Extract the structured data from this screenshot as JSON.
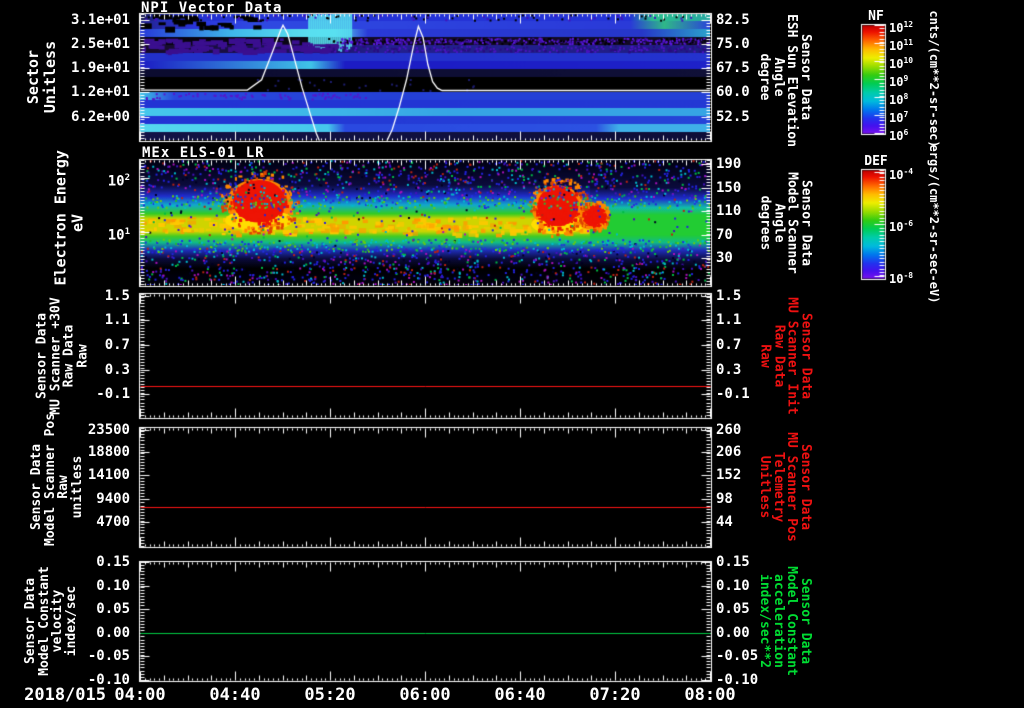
{
  "x_axis": {
    "date_label": "2018/015",
    "tick_labels": [
      "04:00",
      "04:40",
      "05:20",
      "06:00",
      "06:40",
      "07:20",
      "08:00"
    ]
  },
  "panels": [
    {
      "key": "npi",
      "title": "NPI Vector Data",
      "type": "spectrogram",
      "left": {
        "lines": [
          "Sector",
          "Unitless"
        ],
        "ticks": [
          "3.1e+01",
          "2.5e+01",
          "1.9e+01",
          "1.2e+01",
          "6.2e+00"
        ],
        "color": "#ffffff"
      },
      "right": {
        "lines": [
          "Sensor Data",
          "ESH Sun Elevation",
          "Angle",
          "degree"
        ],
        "ticks": [
          "82.5",
          "75.0",
          "67.5",
          "60.0",
          "52.5"
        ],
        "color": "#ffffff"
      }
    },
    {
      "key": "els",
      "title": "MEx ELS-01 LR",
      "type": "spectrogram",
      "left": {
        "lines": [
          "Electron Energy",
          "eV"
        ],
        "ticks": [
          {
            "base": "10",
            "exp": "2"
          },
          {
            "base": "10",
            "exp": "1"
          }
        ],
        "color": "#ffffff"
      },
      "right": {
        "lines": [
          "Sensor Data",
          "Model Scanner",
          "Angle",
          "degrees"
        ],
        "ticks": [
          "190",
          "150",
          "110",
          "70",
          "30"
        ],
        "color": "#ffffff"
      }
    },
    {
      "key": "mu-scanner-30v",
      "type": "line",
      "left": {
        "lines": [
          "Sensor Data",
          "MU Scanner +30V",
          "Raw Data",
          "Raw"
        ],
        "ticks": [
          "1.5",
          "1.1",
          "0.7",
          "0.3",
          "-0.1"
        ],
        "color": "#ffffff"
      },
      "right": {
        "lines": [
          "Sensor Data",
          "MU Scanner Init",
          "Raw Data",
          "Raw"
        ],
        "ticks": [
          "1.5",
          "1.1",
          "0.7",
          "0.3",
          "-0.1"
        ],
        "color": "#ee1111"
      }
    },
    {
      "key": "model-scanner-pos",
      "type": "line",
      "left": {
        "lines": [
          "Sensor Data",
          "Model Scanner Pos",
          "Raw",
          "unitless"
        ],
        "ticks": [
          "23500",
          "18800",
          "14100",
          "9400",
          "4700"
        ],
        "color": "#ffffff"
      },
      "right": {
        "lines": [
          "Sensor Data",
          "MU Scanner Pos",
          "Telemetry",
          "Unitless"
        ],
        "ticks": [
          "260",
          "206",
          "152",
          "98",
          "44"
        ],
        "color": "#ee1111"
      }
    },
    {
      "key": "model-constant",
      "type": "line",
      "left": {
        "lines": [
          "Sensor Data",
          "Model Constant",
          "velocity",
          "index/sec"
        ],
        "ticks": [
          "0.15",
          "0.10",
          "0.05",
          "0.00",
          "-0.05",
          "-0.10"
        ],
        "color": "#ffffff"
      },
      "right": {
        "lines": [
          "Sensor Data",
          "Model Constant",
          "acceleration",
          "index/sec**2"
        ],
        "ticks": [
          "0.15",
          "0.10",
          "0.05",
          "0.00",
          "-0.05",
          "-0.10"
        ],
        "color": "#00dd33"
      }
    }
  ],
  "colorbars": [
    {
      "title": "NF",
      "unit": "cnts/(cm**2-sr-sec)",
      "ticks": [
        {
          "base": "10",
          "exp": "12"
        },
        {
          "base": "10",
          "exp": "11"
        },
        {
          "base": "10",
          "exp": "10"
        },
        {
          "base": "10",
          "exp": "9"
        },
        {
          "base": "10",
          "exp": "8"
        },
        {
          "base": "10",
          "exp": "7"
        },
        {
          "base": "10",
          "exp": "6"
        }
      ]
    },
    {
      "title": "DEF",
      "unit": "ergs/(cm**2-sr-sec-eV)",
      "ticks": [
        {
          "base": "10",
          "exp": "-4"
        },
        {
          "base": "10",
          "exp": "-6"
        },
        {
          "base": "10",
          "exp": "-8"
        }
      ]
    }
  ],
  "colorbar_gradient": [
    [
      0,
      "#c00000"
    ],
    [
      0.06,
      "#ee1100"
    ],
    [
      0.14,
      "#ff6600"
    ],
    [
      0.22,
      "#ffbb00"
    ],
    [
      0.3,
      "#eeee00"
    ],
    [
      0.38,
      "#99dd00"
    ],
    [
      0.46,
      "#33cc11"
    ],
    [
      0.54,
      "#00cc55"
    ],
    [
      0.62,
      "#00ccaa"
    ],
    [
      0.7,
      "#00bbdd"
    ],
    [
      0.78,
      "#0077ee"
    ],
    [
      0.86,
      "#2233ee"
    ],
    [
      0.93,
      "#4411ee"
    ],
    [
      1,
      "#7711ee"
    ]
  ],
  "chart_data": [
    {
      "panel": "NPI Vector Data",
      "type": "heatmap",
      "x_date": "2018/015",
      "x_range": [
        "04:00",
        "08:00"
      ],
      "y_axis": {
        "label": "Sector Unitless",
        "ticks": [
          31,
          25,
          19,
          12,
          6.2
        ]
      },
      "y2_axis": {
        "label": "Sensor Data ESH Sun Elevation Angle (degree)",
        "ticks": [
          82.5,
          75.0,
          67.5,
          60.0,
          52.5
        ]
      },
      "z_axis": {
        "label": "NF cnts/(cm**2-sr-sec)",
        "scale": "log",
        "range": [
          1000000.0,
          1000000000000.0
        ]
      },
      "overlay_series": {
        "name": "white-trace",
        "color": "#ffffff",
        "points_min_value": [
          [
            240,
            13.3
          ],
          [
            285,
            13.3
          ],
          [
            291,
            16
          ],
          [
            296,
            24
          ],
          [
            299,
            29
          ],
          [
            300,
            30.3
          ],
          [
            302,
            28
          ],
          [
            305,
            21
          ],
          [
            308,
            14
          ],
          [
            311,
            8
          ],
          [
            314,
            2
          ],
          [
            316,
            -1
          ],
          [
            343,
            -1
          ],
          [
            346,
            3
          ],
          [
            349,
            9
          ],
          [
            352,
            16
          ],
          [
            355,
            25
          ],
          [
            357,
            30.0
          ],
          [
            359,
            27
          ],
          [
            361,
            20
          ],
          [
            363,
            15.5
          ],
          [
            365,
            13.8
          ],
          [
            367,
            13.2
          ],
          [
            480,
            13.2
          ]
        ]
      },
      "texture": {
        "rows": [
          [
            [
              0,
              "#151540"
            ],
            [
              0.04,
              "#2230cc"
            ],
            [
              0.2,
              "#2433d6"
            ],
            [
              0.86,
              "#2433d6"
            ],
            [
              0.9,
              "#2bbf8f"
            ],
            [
              1,
              "#27a8a0"
            ]
          ],
          [
            [
              0,
              "#23238f"
            ],
            [
              0.1,
              "#2a35dd"
            ],
            [
              0.2,
              "#2f49e2"
            ],
            [
              0.86,
              "#2a3ad8"
            ],
            [
              0.92,
              "#2fb889"
            ],
            [
              1,
              "#2a44d8"
            ]
          ],
          [
            [
              0,
              "#2638d8"
            ],
            [
              0.16,
              "#3fb7ea"
            ],
            [
              0.26,
              "#54d6ee"
            ],
            [
              0.34,
              "#63e4f2"
            ],
            [
              0.4,
              "#2a3ad8"
            ],
            [
              0.88,
              "#2637c9"
            ],
            [
              1,
              "#2ba3cc"
            ]
          ],
          [
            [
              0,
              "#07030f"
            ],
            [
              0.3,
              "#0a0616"
            ],
            [
              0.34,
              "#120a24"
            ],
            [
              1,
              "#120a24"
            ]
          ],
          [
            [
              0,
              "#170b26"
            ],
            [
              0.33,
              "#1d1468"
            ],
            [
              0.42,
              "#232090"
            ],
            [
              1,
              "#201d85"
            ]
          ],
          [
            [
              0,
              "#2230c9"
            ],
            [
              1,
              "#2433cf"
            ]
          ],
          [
            [
              0,
              "#1c1cc4"
            ],
            [
              0.3,
              "#40c4e8"
            ],
            [
              0.36,
              "#1c1cc4"
            ],
            [
              1,
              "#1e22c9"
            ]
          ],
          [
            [
              0,
              "#0c0c30"
            ],
            [
              1,
              "#101038"
            ]
          ],
          [
            [
              0,
              "#000000"
            ],
            [
              1,
              "#000000"
            ]
          ],
          [
            [
              0,
              "#000000"
            ],
            [
              1,
              "#000000"
            ]
          ],
          [
            [
              0,
              "#3fc4e8"
            ],
            [
              0.06,
              "#2a49dd"
            ],
            [
              0.45,
              "#2440d6"
            ],
            [
              1,
              "#2440d6"
            ]
          ],
          [
            [
              0,
              "#2233d4"
            ],
            [
              1,
              "#2338d4"
            ]
          ],
          [
            [
              0,
              "#46c8ec"
            ],
            [
              0.35,
              "#3db4e8"
            ],
            [
              0.55,
              "#36a4e4"
            ],
            [
              1,
              "#36a4e4"
            ]
          ],
          [
            [
              0,
              "#2233d4"
            ],
            [
              1,
              "#2644d8"
            ]
          ],
          [
            [
              0,
              "#55d8ee"
            ],
            [
              0.33,
              "#46c8ec"
            ],
            [
              0.36,
              "#2a49e0"
            ],
            [
              0.8,
              "#2c52e2"
            ],
            [
              0.84,
              "#3fb0e8"
            ],
            [
              1,
              "#3fb0e8"
            ]
          ],
          [
            [
              0,
              "#131347"
            ],
            [
              1,
              "#0e0e38"
            ]
          ]
        ],
        "features": [
          {
            "type": "vstreak",
            "x": [
              0.295,
              0.372
            ],
            "rows": [
              0,
              4
            ],
            "color": "#58e0f0"
          },
          {
            "type": "patches",
            "x": [
              0,
              0.2
            ],
            "rows": [
              0,
              1
            ],
            "color": "#000000",
            "n": 28
          },
          {
            "type": "patches",
            "x": [
              0,
              0.33
            ],
            "rows": [
              3,
              4
            ],
            "color": "#3a0f8f",
            "n": 90
          },
          {
            "type": "speckle",
            "x": [
              0.33,
              1
            ],
            "rows": [
              3,
              3
            ],
            "colors": [
              "#5a17dd",
              "#3d0fa8",
              "#000000"
            ],
            "n": 520
          },
          {
            "type": "speckle",
            "x": [
              0.33,
              1
            ],
            "rows": [
              4,
              4
            ],
            "colors": [
              "#4a13c0",
              "#2a0b80"
            ],
            "n": 260
          },
          {
            "type": "speckle",
            "x": [
              0,
              0.4
            ],
            "rows": [
              10,
              10
            ],
            "colors": [
              "#5517cc"
            ],
            "n": 70
          },
          {
            "type": "speckle",
            "x": [
              0,
              1
            ],
            "rows": [
              0,
              0
            ],
            "colors": [
              "#4412bb",
              "#000000"
            ],
            "n": 90
          },
          {
            "type": "speckle",
            "x": [
              0.2,
              0.6
            ],
            "rows": [
              8,
              9
            ],
            "colors": [
              "#1d1d70"
            ],
            "n": 26
          }
        ]
      }
    },
    {
      "panel": "MEx ELS-01 LR",
      "type": "heatmap",
      "y_axis": {
        "label": "Electron Energy (eV)",
        "scale": "log",
        "ticks": [
          100,
          10
        ]
      },
      "y2_axis": {
        "label": "Sensor Data Model Scanner Angle (degrees)",
        "ticks": [
          190,
          150,
          110,
          70,
          30
        ]
      },
      "z_axis": {
        "label": "DEF ergs/(cm**2-sr-sec-eV)",
        "scale": "log",
        "range": [
          1e-08,
          0.0001
        ]
      },
      "features": [
        {
          "name": "main-flux-band",
          "time": [
            "04:00",
            "08:00"
          ],
          "energy_eV": [
            5,
            30
          ],
          "level": "green-yellow"
        },
        {
          "name": "enhanced-flux-blob",
          "time": [
            "04:39",
            "05:01"
          ],
          "energy_eV": [
            8,
            60
          ],
          "level": "red"
        },
        {
          "name": "enhanced-flux-blob",
          "time": [
            "06:47",
            "07:04"
          ],
          "energy_eV": [
            7,
            50
          ],
          "level": "red"
        },
        {
          "name": "enhanced-flux-blob",
          "time": [
            "07:07",
            "07:15"
          ],
          "energy_eV": [
            10,
            25
          ],
          "level": "red"
        }
      ],
      "texture": {
        "profile": [
          [
            0,
            "#000011"
          ],
          [
            0.2,
            "#0b0b3c"
          ],
          [
            0.29,
            "#1f2ecc"
          ],
          [
            0.36,
            "#11aacc"
          ],
          [
            0.43,
            "#33cc22"
          ],
          [
            0.47,
            "#cfd400"
          ],
          [
            0.57,
            "#cfd400"
          ],
          [
            0.61,
            "#44cc22"
          ],
          [
            0.66,
            "#11bb88"
          ],
          [
            0.72,
            "#1f2ebb"
          ],
          [
            0.79,
            "#0b0b3c"
          ],
          [
            0.87,
            "#000000"
          ],
          [
            0.94,
            "#00000d"
          ],
          [
            1,
            "#000008"
          ]
        ],
        "profile_noyellow": [
          [
            0,
            "#000011"
          ],
          [
            0.22,
            "#0b0b3c"
          ],
          [
            0.31,
            "#1f2ecc"
          ],
          [
            0.38,
            "#11bbaa"
          ],
          [
            0.44,
            "#22cc33"
          ],
          [
            0.6,
            "#22cc33"
          ],
          [
            0.66,
            "#11bb88"
          ],
          [
            0.72,
            "#1f2ebb"
          ],
          [
            0.8,
            "#0b0b3c"
          ],
          [
            0.88,
            "#000000"
          ],
          [
            1,
            "#000008"
          ]
        ],
        "yellow_x": [
          [
            0,
            1
          ],
          [
            0.28,
            0.8
          ],
          [
            0.42,
            1
          ],
          [
            0.7,
            1
          ],
          [
            0.77,
            0.9
          ],
          [
            0.81,
            0
          ],
          [
            1,
            0
          ]
        ],
        "blobs": [
          {
            "cx": 0.209,
            "cy": 0.33,
            "rx": 0.046,
            "ry": 0.17,
            "core": "#ee1404",
            "fringe": "#ff8800"
          },
          {
            "cx": 0.733,
            "cy": 0.37,
            "rx": 0.036,
            "ry": 0.16,
            "core": "#ee1404",
            "fringe": "#ff8800"
          },
          {
            "cx": 0.796,
            "cy": 0.44,
            "rx": 0.018,
            "ry": 0.08,
            "core": "#ee1404",
            "fringe": "#ff8800"
          }
        ],
        "noise": {
          "n": 3000,
          "colors": [
            "#2222dd",
            "#2222dd",
            "#2222dd",
            "#4411bb",
            "#00bbcc",
            "#00bb44",
            "#aa11bb",
            "#bb2211",
            "#000022"
          ]
        }
      }
    },
    {
      "panel": "MU Scanner +30V Raw Data",
      "type": "line",
      "y_range": [
        -0.5,
        1.5
      ],
      "series": [
        {
          "name": "Raw Data Raw",
          "color": "#ff1515",
          "constant_value": 0.0
        }
      ]
    },
    {
      "panel": "Model Scanner Pos Raw",
      "type": "line",
      "y_range": [
        0,
        23500
      ],
      "series": [
        {
          "name": "Raw unitless",
          "color": "#ff1515",
          "constant_value": 7800
        }
      ]
    },
    {
      "panel": "Model Constant velocity",
      "type": "line",
      "y_range": [
        -0.1,
        0.15
      ],
      "series": [
        {
          "name": "velocity index/sec",
          "color": "#00cc44",
          "constant_value": 0.0
        }
      ]
    }
  ]
}
